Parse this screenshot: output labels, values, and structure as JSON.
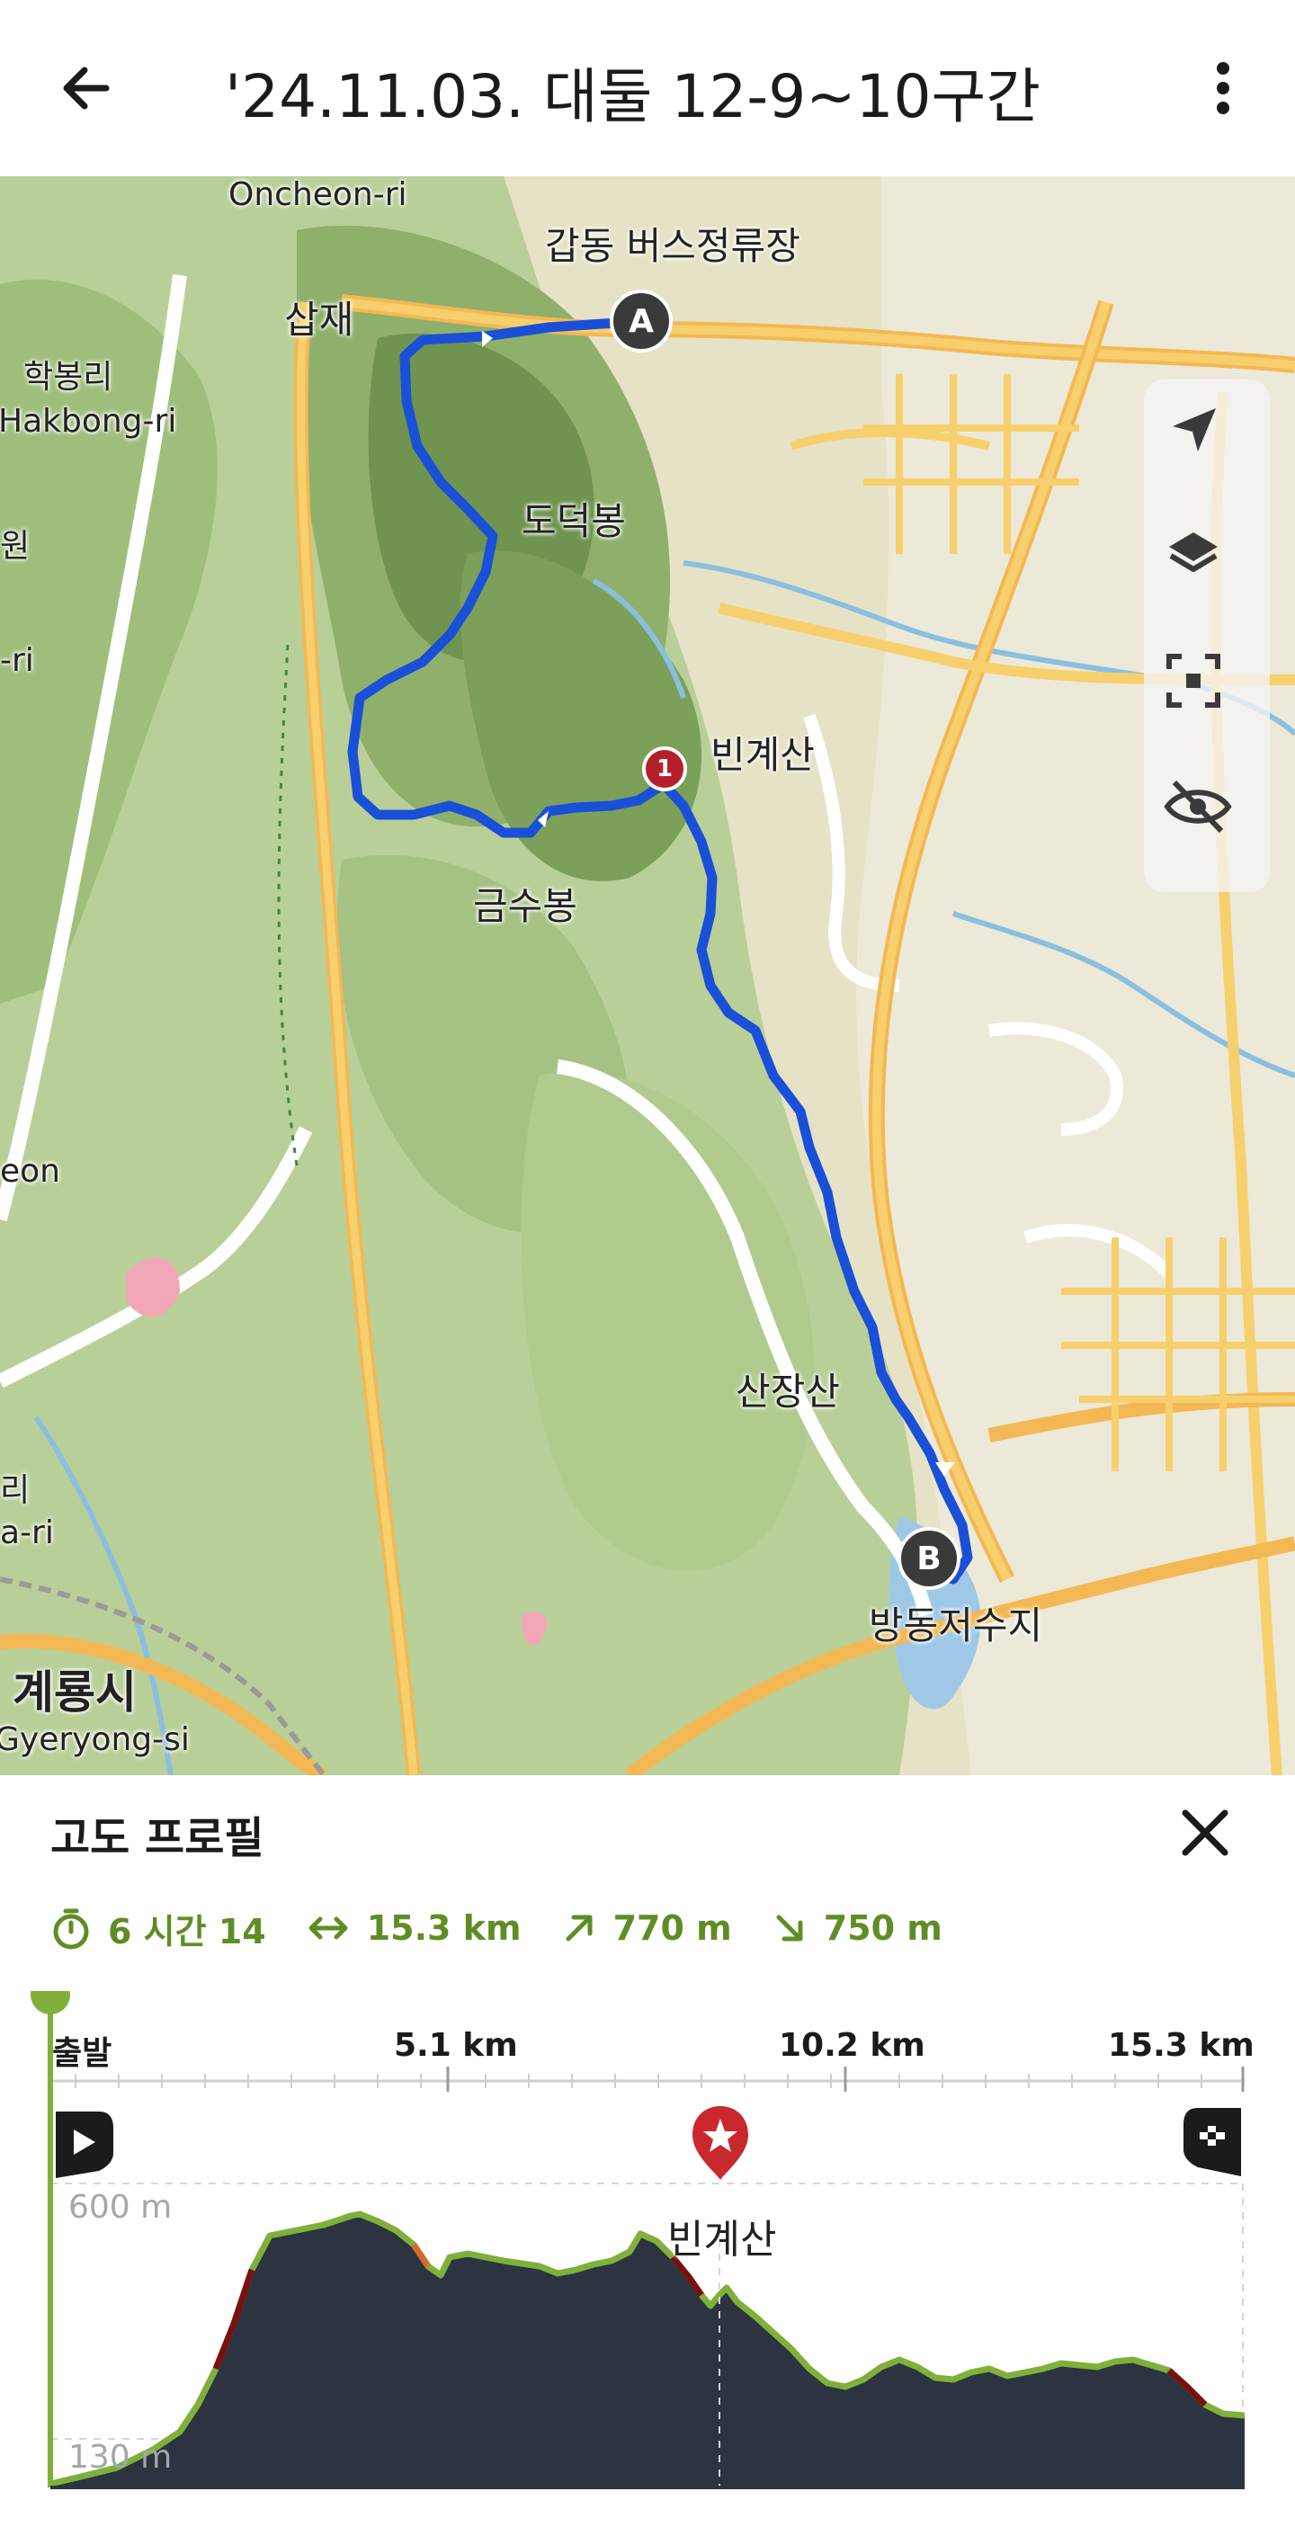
{
  "header": {
    "title": "'24.11.03. 대둘 12-9~10구간"
  },
  "map": {
    "labels": {
      "oncheon": "Oncheon-ri",
      "bus_stop": "갑동 버스정류장",
      "samjae": "삽재",
      "hakbong_ko": "학봉리",
      "hakbong_en": "Hakbong-ri",
      "won": "원",
      "ri": "-ri",
      "dodeokbong": "도덕봉",
      "bingyesan": "빈계산",
      "geumsubong": "금수봉",
      "eon": "eon",
      "sanjangsan": "산장산",
      "ri2": "리",
      "ari": "a-ri",
      "gyeryong_ko": "계룡시",
      "gyeryong_en": "Gyeryong-si",
      "bangdong": "방동저수지"
    },
    "markers": {
      "start": "A",
      "end": "B",
      "waypoint": "1"
    },
    "controls": [
      "navigate-icon",
      "layers-icon",
      "focus-icon",
      "eye-off-icon"
    ]
  },
  "panel": {
    "title": "고도 프로필",
    "stats": {
      "duration": "6 시간 14",
      "distance": "15.3 km",
      "ascent": "770 m",
      "descent": "750 m"
    }
  },
  "profile": {
    "ticks": [
      "출발",
      "5.1 km",
      "10.2 km",
      "15.3 km"
    ],
    "max_alt": "600 m",
    "min_alt": "130 m",
    "peak_label": "빈계산"
  },
  "colors": {
    "route": "#1a4fd8",
    "accent_green": "#6a9a2a",
    "profile_fill": "#2b3440",
    "waypoint_red": "#b5202a"
  }
}
